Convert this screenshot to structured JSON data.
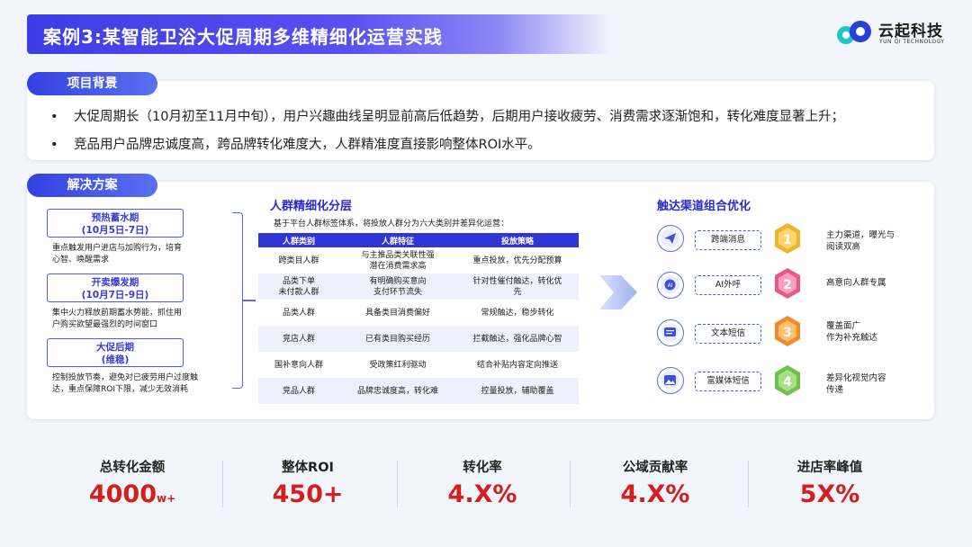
{
  "header": {
    "title": "案例3:某智能卫浴大促周期多维精细化运营实践"
  },
  "logo": {
    "name": "云起科技",
    "subtitle": "YUN QI TECHNOLOGY"
  },
  "background": {
    "label": "项目背景",
    "items": [
      "大促周期长（10月初至11月中旬），用户兴趣曲线呈明显前高后低趋势，后期用户接收疲劳、消费需求逐渐饱和，转化难度显著上升；",
      "竞品用户品牌忠诚度高，跨品牌转化难度大，人群精准度直接影响整体ROI水平。"
    ]
  },
  "solution": {
    "label": "解决方案",
    "phases": [
      {
        "title": "预热蓄水期",
        "date": "(10月5日-7日)",
        "desc1": "重点触发用户进店与加购行为，培育",
        "desc2": "心智、唤醒需求"
      },
      {
        "title": "开卖爆发期",
        "date": "(10月7日-9日)",
        "desc1": "集中火力释放前期蓄水势能，抓住用",
        "desc2": "户购买欲望最强烈的时间窗口"
      },
      {
        "title": "大促后期",
        "date": "(维稳)",
        "desc1": "控制投放节奏，避免对已疲劳用户过度触",
        "desc2": "达，重点保障ROI下限，减少无效消耗"
      }
    ]
  },
  "segmentation": {
    "title": "人群精细化分层",
    "subtitle": "基于平台人群标签体系，将投放人群分为六大类别并差异化运营：",
    "headers": [
      "人群类别",
      "人群特征",
      "投放策略"
    ],
    "rows": [
      {
        "cat": "跨类目人群",
        "feat1": "与主推品类关联性强",
        "feat2": "潜在消费需求高",
        "strat1": "重点投放，优先分配预算",
        "strat2": ""
      },
      {
        "cat": "品类下单",
        "cat2": "未付款人群",
        "feat1": "有明确购买意向",
        "feat2": "支付环节流失",
        "strat1": "针对性催付触达，转化优",
        "strat2": "先"
      },
      {
        "cat": "品类人群",
        "feat1": "具备类目消费偏好",
        "feat2": "",
        "strat1": "常规触达，稳步转化",
        "strat2": ""
      },
      {
        "cat": "竞店人群",
        "feat1": "已有类目购买经历",
        "feat2": "",
        "strat1": "拦截触达，强化品牌心智",
        "strat2": ""
      },
      {
        "cat": "国补意向人群",
        "feat1": "受政策红利驱动",
        "feat2": "",
        "strat1": "结合补贴内容定向推送",
        "strat2": ""
      },
      {
        "cat": "竞品人群",
        "feat1": "品牌忠诚度高，转化难",
        "feat2": "",
        "strat1": "控量投放，辅助覆盖",
        "strat2": ""
      }
    ]
  },
  "channels": {
    "title": "触达渠道组合优化",
    "items": [
      {
        "icon": "paper-plane-icon",
        "label": "跨端消息",
        "rank": "1",
        "desc1": "主力渠道，曝光与",
        "desc2": "阅读双高"
      },
      {
        "icon": "ai-phone-icon",
        "label": "AI外呼",
        "rank": "2",
        "desc1": "高意向人群专属",
        "desc2": ""
      },
      {
        "icon": "message-icon",
        "label": "文本短信",
        "rank": "3",
        "desc1": "覆盖面广",
        "desc2": "作为补充触达"
      },
      {
        "icon": "image-message-icon",
        "label": "富媒体短信",
        "rank": "4",
        "desc1": "差异化视觉内容",
        "desc2": "传递"
      }
    ],
    "colors": {
      "gold": "#f2b32a",
      "pink": "#e8578a",
      "orange": "#f08a2a",
      "green": "#6cc24a"
    }
  },
  "metrics": [
    {
      "name": "总转化金额",
      "value": "4000",
      "suffix": "w+"
    },
    {
      "name": "整体ROI",
      "value": "450+",
      "suffix": ""
    },
    {
      "name": "转化率",
      "value": "4.X%",
      "suffix": ""
    },
    {
      "name": "公域贡献率",
      "value": "4.X%",
      "suffix": ""
    },
    {
      "name": "进店率峰值",
      "value": "5X%",
      "suffix": ""
    }
  ]
}
